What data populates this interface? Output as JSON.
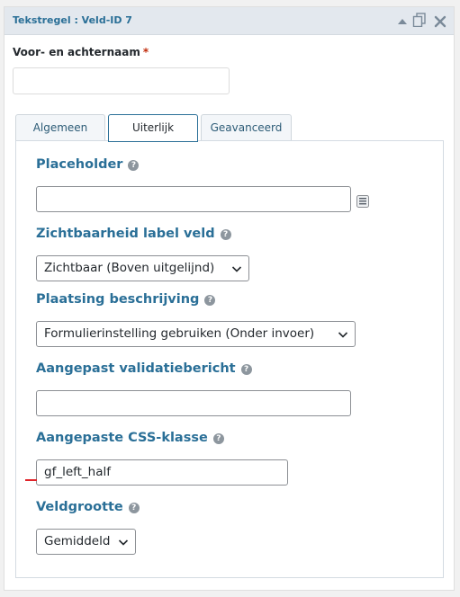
{
  "panel": {
    "title": "Tekstregel : Veld-ID 7",
    "icons": [
      "collapse-icon",
      "duplicate-icon",
      "close-icon"
    ]
  },
  "preview": {
    "label": "Voor- en achternaam",
    "required_marker": "*",
    "value": ""
  },
  "tabs": [
    {
      "label": "Algemeen",
      "active": false
    },
    {
      "label": "Uiterlijk",
      "active": true
    },
    {
      "label": "Geavanceerd",
      "active": false
    }
  ],
  "settings": {
    "placeholder": {
      "label": "Placeholder",
      "value": ""
    },
    "label_visibility": {
      "label": "Zichtbaarheid label veld",
      "selected": "Zichtbaar (Boven uitgelijnd)"
    },
    "description_placement": {
      "label": "Plaatsing beschrijving",
      "selected": "Formulierinstelling gebruiken (Onder invoer)"
    },
    "validation_message": {
      "label": "Aangepast validatiebericht",
      "value": ""
    },
    "css_class": {
      "label": "Aangepaste CSS-klasse",
      "value": "gf_left_half"
    },
    "field_size": {
      "label": "Veldgrootte",
      "selected": "Gemiddeld"
    }
  },
  "help_glyph": "?",
  "colors": {
    "accent": "#2a6f97",
    "title_bar": "#e3e8ee",
    "required": "#c02b0a",
    "marker": "#e0242a"
  }
}
